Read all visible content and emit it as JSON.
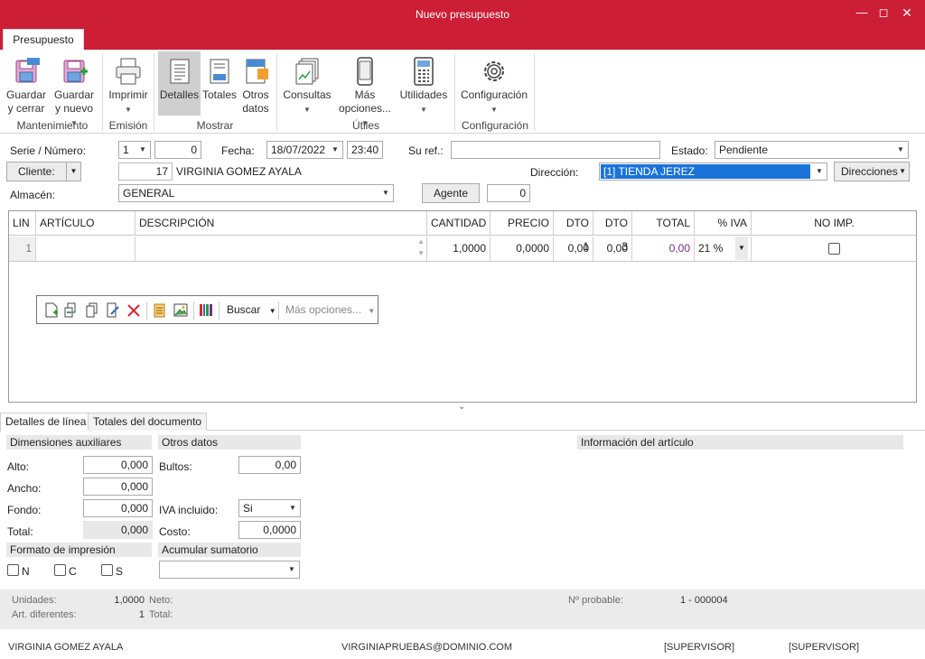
{
  "window": {
    "title": "Nuevo presupuesto"
  },
  "ribbon": {
    "tab": "Presupuesto",
    "buttons": {
      "guardar_cerrar": [
        "Guardar",
        "y cerrar"
      ],
      "guardar_nuevo": [
        "Guardar",
        "y nuevo"
      ],
      "imprimir": "Imprimir",
      "detalles": "Detalles",
      "totales": "Totales",
      "otros_datos": [
        "Otros",
        "datos"
      ],
      "consultas": "Consultas",
      "mas_opciones": [
        "Más",
        "opciones..."
      ],
      "utilidades": "Utilidades",
      "configuracion": "Configuración"
    },
    "groups": {
      "mantenimiento": "Mantenimiento",
      "emision": "Emisión",
      "mostrar": "Mostrar",
      "utiles": "Útiles",
      "configuracion": "Configuración"
    }
  },
  "form": {
    "serie_label": "Serie / Número:",
    "serie_value": "1",
    "numero_value": "0",
    "fecha_label": "Fecha:",
    "fecha_value": "18/07/2022",
    "hora_value": "23:40",
    "su_ref_label": "Su ref.:",
    "su_ref_value": "",
    "estado_label": "Estado:",
    "estado_value": "Pendiente",
    "cliente_button": "Cliente:",
    "cliente_code": "17",
    "cliente_name": "VIRGINIA GOMEZ AYALA",
    "direccion_label": "Dirección:",
    "direccion_value": "[1]  TIENDA JEREZ",
    "direcciones_button": "Direcciones",
    "almacen_label": "Almacén:",
    "almacen_value": "GENERAL",
    "agente_button": "Agente",
    "agente_value": "0"
  },
  "grid": {
    "columns": [
      "LIN",
      "ARTÍCULO",
      "DESCRIPCIÓN",
      "CANTIDAD",
      "PRECIO",
      "DTO 1",
      "DTO 3",
      "TOTAL",
      "% IVA",
      "NO IMP."
    ],
    "rows": [
      {
        "lin": "1",
        "articulo": "",
        "descripcion": "",
        "cantidad": "1,0000",
        "precio": "0,0000",
        "dto1": "0,00",
        "dto3": "0,00",
        "total": "0,00",
        "iva": "21 %",
        "no_imp": false
      }
    ],
    "toolbar": {
      "buscar": "Buscar",
      "mas_opciones": "Más opciones..."
    }
  },
  "lower": {
    "tabs": [
      "Detalles de línea",
      "Totales del documento"
    ],
    "dimensiones_title": "Dimensiones auxiliares",
    "alto_label": "Alto:",
    "alto_value": "0,000",
    "ancho_label": "Ancho:",
    "ancho_value": "0,000",
    "fondo_label": "Fondo:",
    "fondo_value": "0,000",
    "total_label": "Total:",
    "total_value": "0,000",
    "otros_title": "Otros datos",
    "bultos_label": "Bultos:",
    "bultos_value": "0,00",
    "iva_incluido_label": "IVA incluido:",
    "iva_incluido_value": "Si",
    "costo_label": "Costo:",
    "costo_value": "0,0000",
    "info_title": "Información del artículo",
    "formato_title": "Formato de impresión",
    "formato_options": [
      "N",
      "C",
      "S"
    ],
    "acumular_title": "Acumular sumatorio",
    "acumular_value": ""
  },
  "summary": {
    "unidades_label": "Unidades:",
    "unidades_value": "1,0000",
    "neto_label": "Neto:",
    "art_dif_label": "Art. diferentes:",
    "art_dif_value": "1",
    "total_label": "Total:",
    "probable_label": "Nº probable:",
    "probable_value": "1 - 000004"
  },
  "status": {
    "user": "VIRGINIA GOMEZ AYALA",
    "email": "VIRGINIAPRUEBAS@DOMINIO.COM",
    "role1": "[SUPERVISOR]",
    "role2": "[SUPERVISOR]"
  },
  "colors": {
    "accent": "#cc1e35",
    "selection": "#1a73d9"
  }
}
